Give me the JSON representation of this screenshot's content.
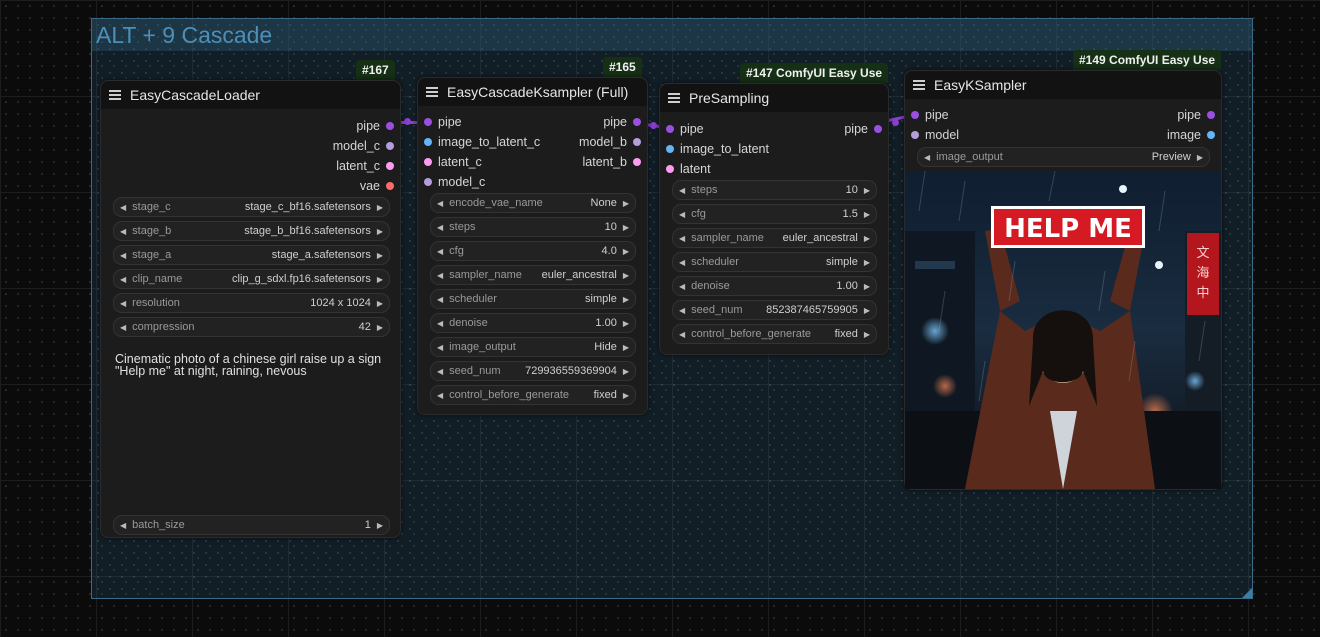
{
  "colors": {
    "pipe": "#9b4fe0",
    "model": "#b39ddb",
    "latent": "#ff9cf0",
    "vae": "#ff6b6b",
    "image": "#64b5f6",
    "group_border": "#3c6a86",
    "badge_bg": "#163016",
    "link": "#8b3fd0"
  },
  "group": {
    "title": "ALT + 9 Cascade"
  },
  "nodes": {
    "loader": {
      "badge": "#167",
      "title": "EasyCascadeLoader",
      "outputs": [
        "pipe",
        "model_c",
        "latent_c",
        "vae"
      ],
      "widgets": [
        {
          "name": "stage_c",
          "value": "stage_c_bf16.safetensors"
        },
        {
          "name": "stage_b",
          "value": "stage_b_bf16.safetensors"
        },
        {
          "name": "stage_a",
          "value": "stage_a.safetensors"
        },
        {
          "name": "clip_name",
          "value": "clip_g_sdxl.fp16.safetensors"
        },
        {
          "name": "resolution",
          "value": "1024 x 1024"
        },
        {
          "name": "compression",
          "value": "42"
        }
      ],
      "prompt_line1": "Cinematic photo of a chinese girl raise up a sign",
      "prompt_line2": "\"Help me\" at night, raining, nevous",
      "batch": {
        "name": "batch_size",
        "value": "1"
      }
    },
    "ksampler": {
      "badge": "#165",
      "title": "EasyCascadeKsampler (Full)",
      "inputs": [
        "pipe",
        "image_to_latent_c",
        "latent_c",
        "model_c"
      ],
      "outputs": [
        "pipe",
        "model_b",
        "latent_b"
      ],
      "widgets": [
        {
          "name": "encode_vae_name",
          "value": "None"
        },
        {
          "name": "steps",
          "value": "10"
        },
        {
          "name": "cfg",
          "value": "4.0"
        },
        {
          "name": "sampler_name",
          "value": "euler_ancestral"
        },
        {
          "name": "scheduler",
          "value": "simple"
        },
        {
          "name": "denoise",
          "value": "1.00"
        },
        {
          "name": "image_output",
          "value": "Hide"
        },
        {
          "name": "seed_num",
          "value": "729936559369904"
        },
        {
          "name": "control_before_generate",
          "value": "fixed"
        }
      ]
    },
    "presampling": {
      "badge": "#147 ComfyUI Easy Use",
      "title": "PreSampling",
      "inputs": [
        "pipe",
        "image_to_latent",
        "latent"
      ],
      "outputs": [
        "pipe"
      ],
      "widgets": [
        {
          "name": "steps",
          "value": "10"
        },
        {
          "name": "cfg",
          "value": "1.5"
        },
        {
          "name": "sampler_name",
          "value": "euler_ancestral"
        },
        {
          "name": "scheduler",
          "value": "simple"
        },
        {
          "name": "denoise",
          "value": "1.00"
        },
        {
          "name": "seed_num",
          "value": "852387465759905"
        },
        {
          "name": "control_before_generate",
          "value": "fixed"
        }
      ]
    },
    "easyksampler": {
      "badge": "#149 ComfyUI Easy Use",
      "title": "EasyKSampler",
      "inputs": [
        "pipe",
        "model"
      ],
      "outputs": [
        "pipe",
        "image"
      ],
      "widget": {
        "name": "image_output",
        "value": "Preview"
      },
      "image_sign": "HELP ME"
    }
  }
}
